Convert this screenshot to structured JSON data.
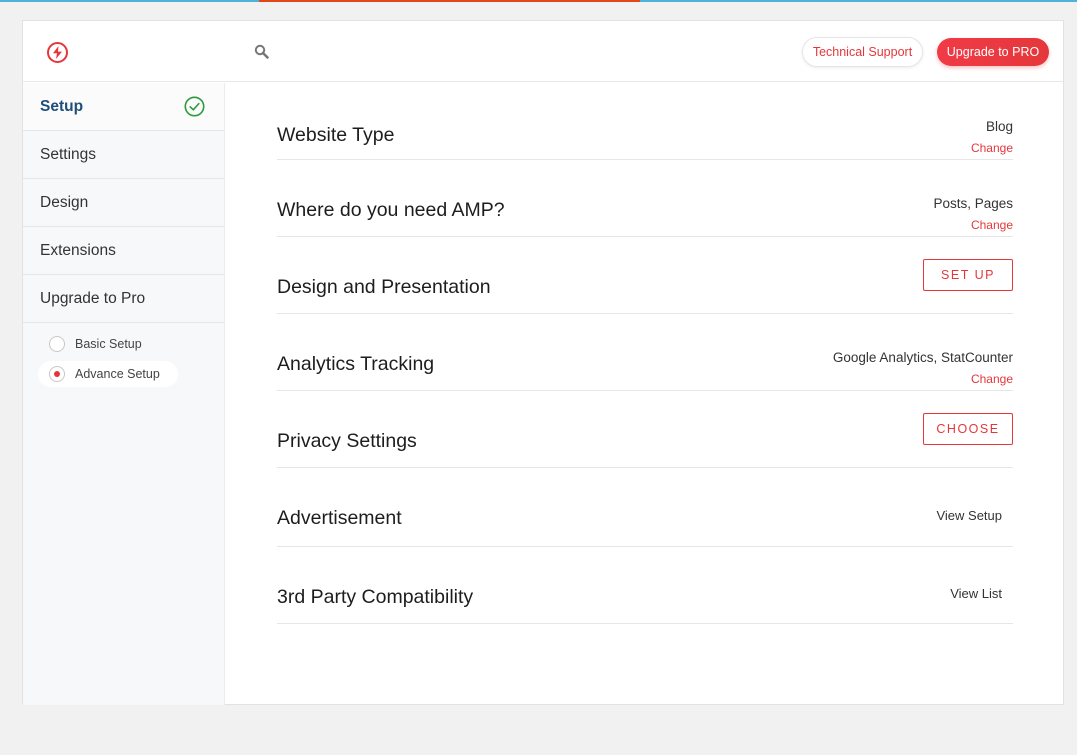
{
  "header": {
    "support_label": "Technical Support",
    "upgrade_label": "Upgrade to PRO"
  },
  "colors": {
    "accent": "#e5373b",
    "nav_active": "#1e4e79",
    "check": "#2e9a3e",
    "top_bar": "#4fb3d9",
    "top_bar_accent": "#e0481a"
  },
  "icons": {
    "logo": "lightning-bolt-icon",
    "search": "search-icon",
    "setup_done": "check-circle-icon"
  },
  "sidebar": {
    "items": [
      {
        "label": "Setup"
      },
      {
        "label": "Settings"
      },
      {
        "label": "Design"
      },
      {
        "label": "Extensions"
      },
      {
        "label": "Upgrade to Pro"
      }
    ],
    "sub_items": [
      {
        "label": "Basic Setup"
      },
      {
        "label": "Advance Setup"
      }
    ]
  },
  "rows": [
    {
      "title": "Website Type",
      "value": "Blog",
      "action": "Change"
    },
    {
      "title": "Where do you need AMP?",
      "value": "Posts, Pages",
      "action": "Change"
    },
    {
      "title": "Design and Presentation",
      "action": "SET UP"
    },
    {
      "title": "Analytics Tracking",
      "value": "Google Analytics, StatCounter",
      "action": "Change"
    },
    {
      "title": "Privacy Settings",
      "action": "CHOOSE"
    },
    {
      "title": "Advertisement",
      "action": "View Setup"
    },
    {
      "title": "3rd Party Compatibility",
      "action": "View List"
    }
  ]
}
